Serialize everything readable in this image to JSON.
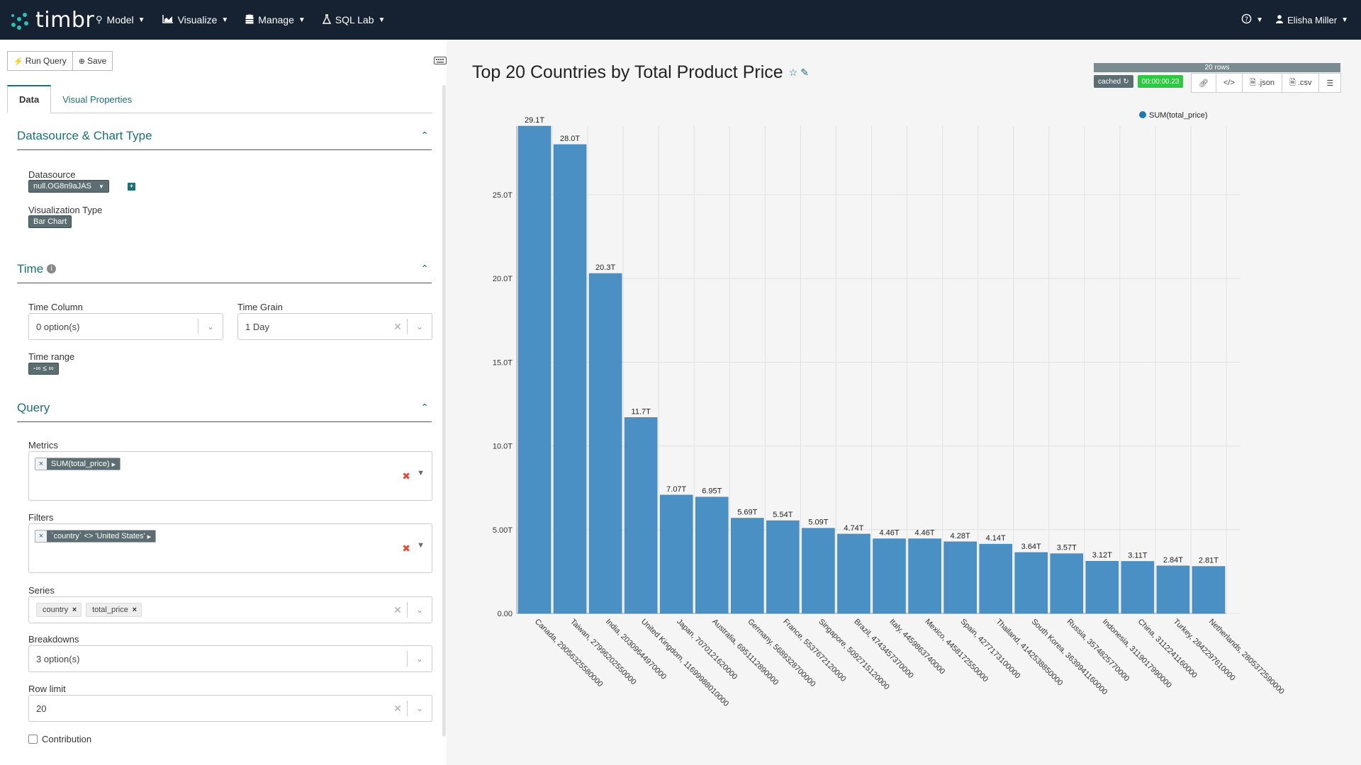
{
  "nav": {
    "logo": "timbr",
    "menu": [
      {
        "label": "Model",
        "icon": "map-pin-icon"
      },
      {
        "label": "Visualize",
        "icon": "area-chart-icon"
      },
      {
        "label": "Manage",
        "icon": "database-icon"
      },
      {
        "label": "SQL Lab",
        "icon": "flask-icon"
      }
    ],
    "help_icon": "question-circle-icon",
    "user": "Elisha Miller"
  },
  "toolbar": {
    "run_label": "Run Query",
    "save_label": "Save"
  },
  "tabs": [
    {
      "label": "Data",
      "active": true
    },
    {
      "label": "Visual Properties",
      "active": false
    }
  ],
  "sections": {
    "datasource_title": "Datasource & Chart Type",
    "time_title": "Time",
    "query_title": "Query"
  },
  "datasource": {
    "label": "Datasource",
    "value": "null.OG8n9aJAS"
  },
  "viz_type": {
    "label": "Visualization Type",
    "value": "Bar Chart"
  },
  "time_column": {
    "label": "Time Column",
    "value": "0 option(s)"
  },
  "time_grain": {
    "label": "Time Grain",
    "value": "1 Day"
  },
  "time_range": {
    "label": "Time range",
    "value": "-∞ ≤ ∞"
  },
  "metrics": {
    "label": "Metrics",
    "chip": "SUM(total_price)"
  },
  "filters": {
    "label": "Filters",
    "chip": "`country` <> 'United States'"
  },
  "series": {
    "label": "Series",
    "chips": [
      "country",
      "total_price"
    ]
  },
  "breakdowns": {
    "label": "Breakdowns",
    "value": "3 option(s)"
  },
  "row_limit": {
    "label": "Row limit",
    "value": "20"
  },
  "contribution": {
    "label": "Contribution",
    "checked": false
  },
  "chart_header": {
    "title": "Top 20 Countries by Total Product Price",
    "rows": "20 rows",
    "cached": "cached",
    "time": "00:00:00.23",
    "buttons": [
      "link-icon",
      "code-icon",
      ".json",
      ".csv",
      "menu-icon"
    ]
  },
  "colors": {
    "bar": "#4a90c4",
    "accent": "#1e6f73",
    "nav_bg": "#162132"
  },
  "chart_data": {
    "type": "bar",
    "title": "Top 20 Countries by Total Product Price",
    "legend": [
      "SUM(total_price)"
    ],
    "legend_position": "top-right",
    "grid": true,
    "ylim": [
      0,
      29.1
    ],
    "yticks": [
      "0.00",
      "5.00T",
      "10.0T",
      "15.0T",
      "20.0T",
      "25.0T"
    ],
    "ytick_values": [
      0,
      5,
      10,
      15,
      20,
      25
    ],
    "categories": [
      "Canada, 29056325580000",
      "Taiwan, 27996202550000",
      "India, 20309644970000",
      "United Kingdom, 11699988010000",
      "Japan, 7070121620000",
      "Australia, 6951112890000",
      "Germany, 5689328700000",
      "France, 5537672120000",
      "Singapore, 5092715120000",
      "Brazil, 4743457370000",
      "Italy, 4459863740000",
      "Mexico, 4458172550000",
      "Spain, 4277173100000",
      "Thailand, 4142538850000",
      "South Korea, 3639941160000",
      "Russia, 3574825770000",
      "Indonesia, 3119017990000",
      "China, 3112241160000",
      "Turkey, 2842297610000",
      "Netherlands, 2805372590000"
    ],
    "values": [
      29.1,
      28.0,
      20.3,
      11.7,
      7.07,
      6.95,
      5.69,
      5.54,
      5.09,
      4.74,
      4.46,
      4.46,
      4.28,
      4.14,
      3.64,
      3.57,
      3.12,
      3.11,
      2.84,
      2.81
    ],
    "labels": [
      "29.1T",
      "28.0T",
      "20.3T",
      "11.7T",
      "7.07T",
      "6.95T",
      "5.69T",
      "5.54T",
      "5.09T",
      "4.74T",
      "4.46T",
      "4.46T",
      "4.28T",
      "4.14T",
      "3.64T",
      "3.57T",
      "3.12T",
      "3.11T",
      "2.84T",
      "2.81T"
    ]
  }
}
